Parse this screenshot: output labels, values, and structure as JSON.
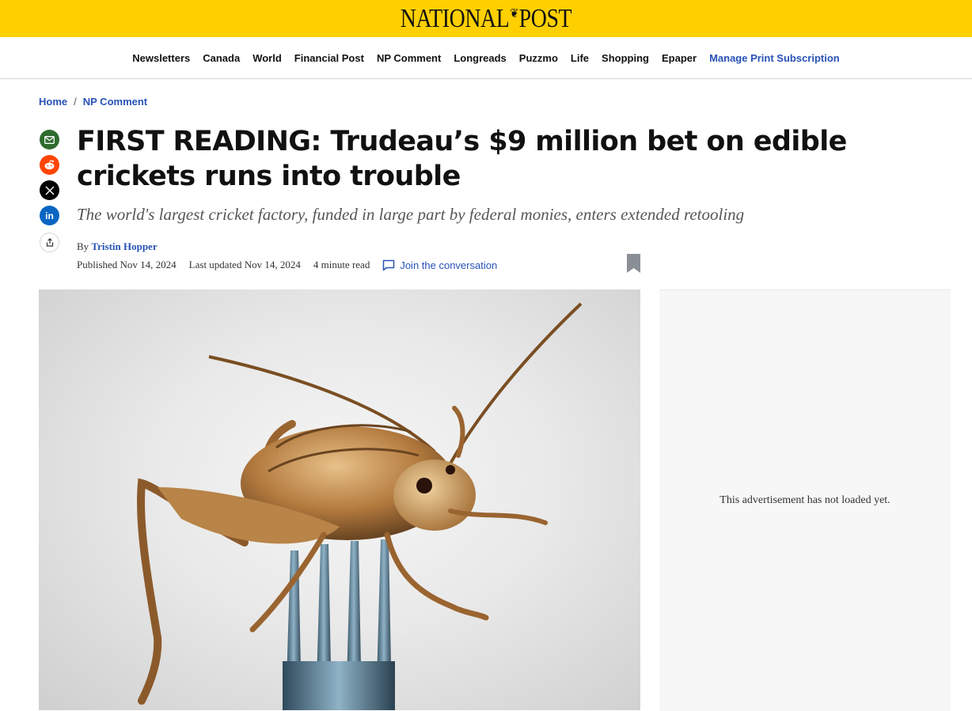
{
  "header": {
    "logo_left": "NATIONAL",
    "logo_right": "POST",
    "logo_leaf": "❦"
  },
  "nav": {
    "items": [
      "Newsletters",
      "Canada",
      "World",
      "Financial Post",
      "NP Comment",
      "Longreads",
      "Puzzmo",
      "Life",
      "Shopping",
      "Epaper"
    ],
    "manage_link": "Manage Print Subscription"
  },
  "breadcrumb": {
    "home": "Home",
    "separator": "/",
    "section": "NP Comment"
  },
  "share": {
    "icons": [
      "email-icon",
      "reddit-icon",
      "x-icon",
      "linkedin-icon",
      "share-icon"
    ],
    "colors": {
      "email": "#2E6B2E",
      "reddit": "#FF4500",
      "x": "#000000",
      "linkedin": "#0A66C2"
    }
  },
  "article": {
    "headline": "FIRST READING: Trudeau’s $9 million bet on edible crickets runs into trouble",
    "dek": "The world's largest cricket factory, funded in large part by federal monies, enters extended retooling",
    "by_prefix": "By",
    "author": "Tristin Hopper",
    "published": "Published Nov 14, 2024",
    "updated": "Last updated Nov 14, 2024",
    "read_time": "4 minute read",
    "conversation": "Join the conversation"
  },
  "ad": {
    "text": "This advertisement has not loaded yet."
  },
  "colors": {
    "brand_yellow": "#FFD000",
    "link_blue": "#2852B6"
  }
}
